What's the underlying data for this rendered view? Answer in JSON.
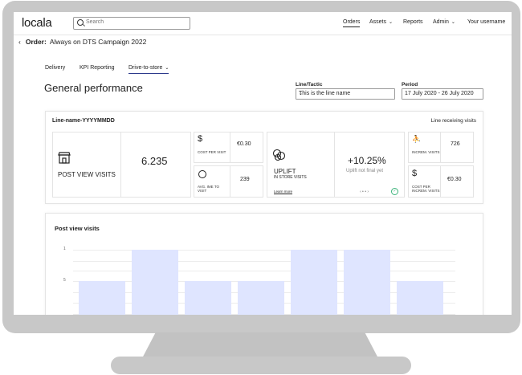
{
  "app": {
    "logo": "locala"
  },
  "search": {
    "placeholder": "Search"
  },
  "nav": {
    "orders": "Orders",
    "assets": "Assets",
    "reports": "Reports",
    "admin": "Admin",
    "user": "Your username"
  },
  "order": {
    "back": "‹",
    "label": "Order:",
    "name": "Always on DTS Campaign 2022"
  },
  "tabs": [
    {
      "label": "Delivery"
    },
    {
      "label": "KPI Reporting"
    },
    {
      "label": "Drive-to-store"
    }
  ],
  "performance": {
    "title": "General performance",
    "line_label": "Line/Tactic",
    "line_value": "This is the line name",
    "period_label": "Period",
    "period_value": "17 July 2020 - 26 July 2020"
  },
  "summary": {
    "line_name": "Line-name-YYYYMMDD",
    "receiving": "Line receiving visits",
    "post_view_label": "POST VIEW VISITS",
    "post_view_value": "6.235",
    "cost_per_visit_label": "COST PER VISIT",
    "cost_per_visit_value": "€0.30",
    "avg_time_label": "AVG. IME TO VISIT",
    "avg_time_value": "239",
    "uplift_label": "UPLIFT",
    "uplift_sub": "IN STORE VISITS",
    "learn_more": "Learn more",
    "uplift_value": "+10.25%",
    "uplift_note": "Uplift not final yet",
    "increm_label": "INCREM. VISITS",
    "increm_value": "726",
    "cost_increm_label": "COST PER INCREM. VISITS",
    "cost_increm_value": "€0.30"
  },
  "chart_data": {
    "type": "bar",
    "title": "Post view visits",
    "ytick_labels": [
      "1",
      "5"
    ],
    "values": [
      5,
      1,
      5,
      5,
      1,
      1,
      5
    ],
    "bar_color": "#dfe5ff"
  }
}
